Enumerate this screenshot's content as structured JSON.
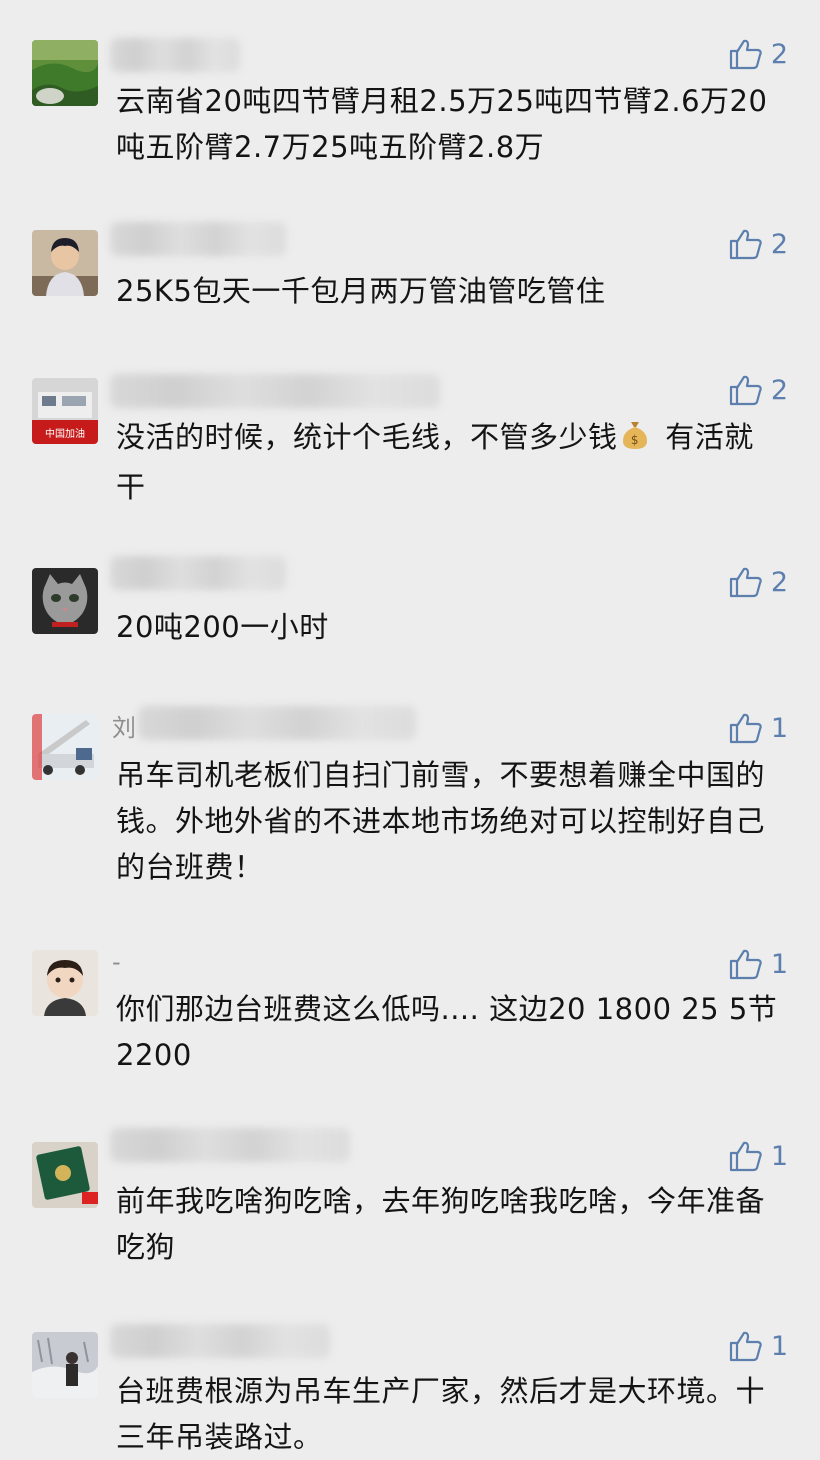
{
  "comments": [
    {
      "likes": "2",
      "text": "云南省20吨四节臂月租2.5万25吨四节臂2.6万20吨五阶臂2.7万25吨五阶臂2.8万"
    },
    {
      "likes": "2",
      "text": "25K5包天一千包月两万管油管吃管住"
    },
    {
      "likes": "2",
      "text_before_icon": "没活的时候，统计个毛线，不管多少钱",
      "icon": "money-bag-icon",
      "text_after_icon": " 有活就干",
      "avatar_caption": "中国加油"
    },
    {
      "likes": "2",
      "text": "20吨200一小时"
    },
    {
      "likes": "1",
      "name_prefix": "刘",
      "text": "吊车司机老板们自扫门前雪，不要想着赚全中国的钱。外地外省的不进本地市场绝对可以控制好自己的台班费！"
    },
    {
      "likes": "1",
      "name_prefix": "-",
      "text": "你们那边台班费这么低吗.... 这边20 1800 25 5节2200"
    },
    {
      "likes": "1",
      "text": "前年我吃啥狗吃啥，去年狗吃啥我吃啥，今年准备吃狗"
    },
    {
      "likes": "1",
      "text": "台班费根源为吊车生产厂家，然后才是大环境。十三年吊装路过。"
    }
  ],
  "colors": {
    "background": "#ededed",
    "text": "#141414",
    "like_accent": "#5d7fae"
  }
}
